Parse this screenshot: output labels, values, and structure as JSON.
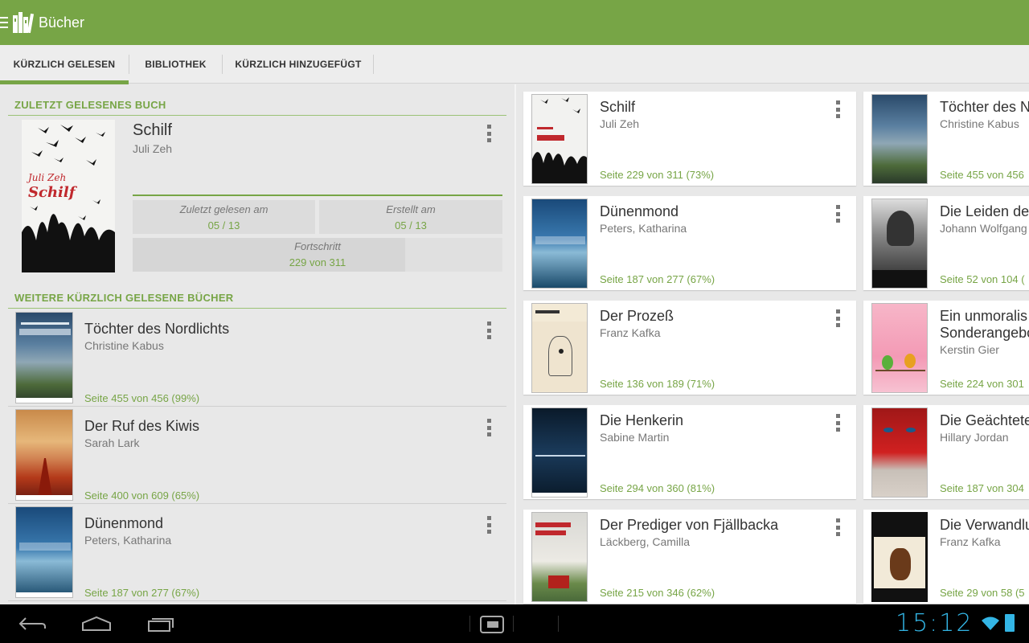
{
  "app": {
    "title": "Bücher"
  },
  "tabs": [
    {
      "label": "KÜRZLICH GELESEN",
      "active": true
    },
    {
      "label": "BIBLIOTHEK",
      "active": false
    },
    {
      "label": "KÜRZLICH HINZUGEFÜGT",
      "active": false
    }
  ],
  "last_read": {
    "section_title": "ZULETZT GELESENES BUCH",
    "title": "Schilf",
    "author": "Juli Zeh",
    "last_read_label": "Zuletzt gelesen am",
    "last_read_value": "05 / 13",
    "created_label": "Erstellt am",
    "created_value": "05 / 13",
    "progress_label": "Fortschritt",
    "progress_value": "229 von 311",
    "progress_fraction": 0.736,
    "cover_text_author": "Juli Zeh",
    "cover_text_title": "Schilf"
  },
  "more_recent": {
    "section_title": "WEITERE KÜRZLICH GELESENE BÜCHER",
    "items": [
      {
        "title": "Töchter des Nordlichts",
        "author": "Christine Kabus",
        "progress": "Seite 455 von 456 (99%)"
      },
      {
        "title": "Der Ruf des Kiwis",
        "author": "Sarah Lark",
        "progress": "Seite 400 von 609 (65%)"
      },
      {
        "title": "Dünenmond",
        "author": "Peters, Katharina",
        "progress": "Seite 187 von 277 (67%)"
      }
    ]
  },
  "cards_col1": [
    {
      "title": "Schilf",
      "author": "Juli Zeh",
      "progress": "Seite 229 von 311 (73%)"
    },
    {
      "title": "Dünenmond",
      "author": "Peters, Katharina",
      "progress": "Seite 187 von 277 (67%)"
    },
    {
      "title": "Der Prozeß",
      "author": "Franz Kafka",
      "progress": "Seite 136 von 189 (71%)"
    },
    {
      "title": "Die Henkerin",
      "author": "Sabine Martin",
      "progress": "Seite 294 von 360 (81%)"
    },
    {
      "title": "Der Prediger von Fjällbacka",
      "author": "Läckberg, Camilla",
      "progress": "Seite 215 von 346 (62%)"
    }
  ],
  "cards_col2": [
    {
      "title": "Töchter des N",
      "author": "Christine Kabus",
      "progress": "Seite 455 von 456"
    },
    {
      "title": "Die Leiden des",
      "author": "Johann Wolfgang",
      "progress": "Seite 52 von 104 ("
    },
    {
      "title": "Ein unmoralis",
      "title2": "Sonderangebo",
      "author": "Kerstin Gier",
      "progress": "Seite 224 von 301"
    },
    {
      "title": "Die Geächtete",
      "author": "Hillary Jordan",
      "progress": "Seite 187 von 304"
    },
    {
      "title": "Die Verwandlu",
      "author": "Franz Kafka",
      "progress": "Seite 29 von 58 (5"
    }
  ],
  "status": {
    "time": "15:12"
  }
}
